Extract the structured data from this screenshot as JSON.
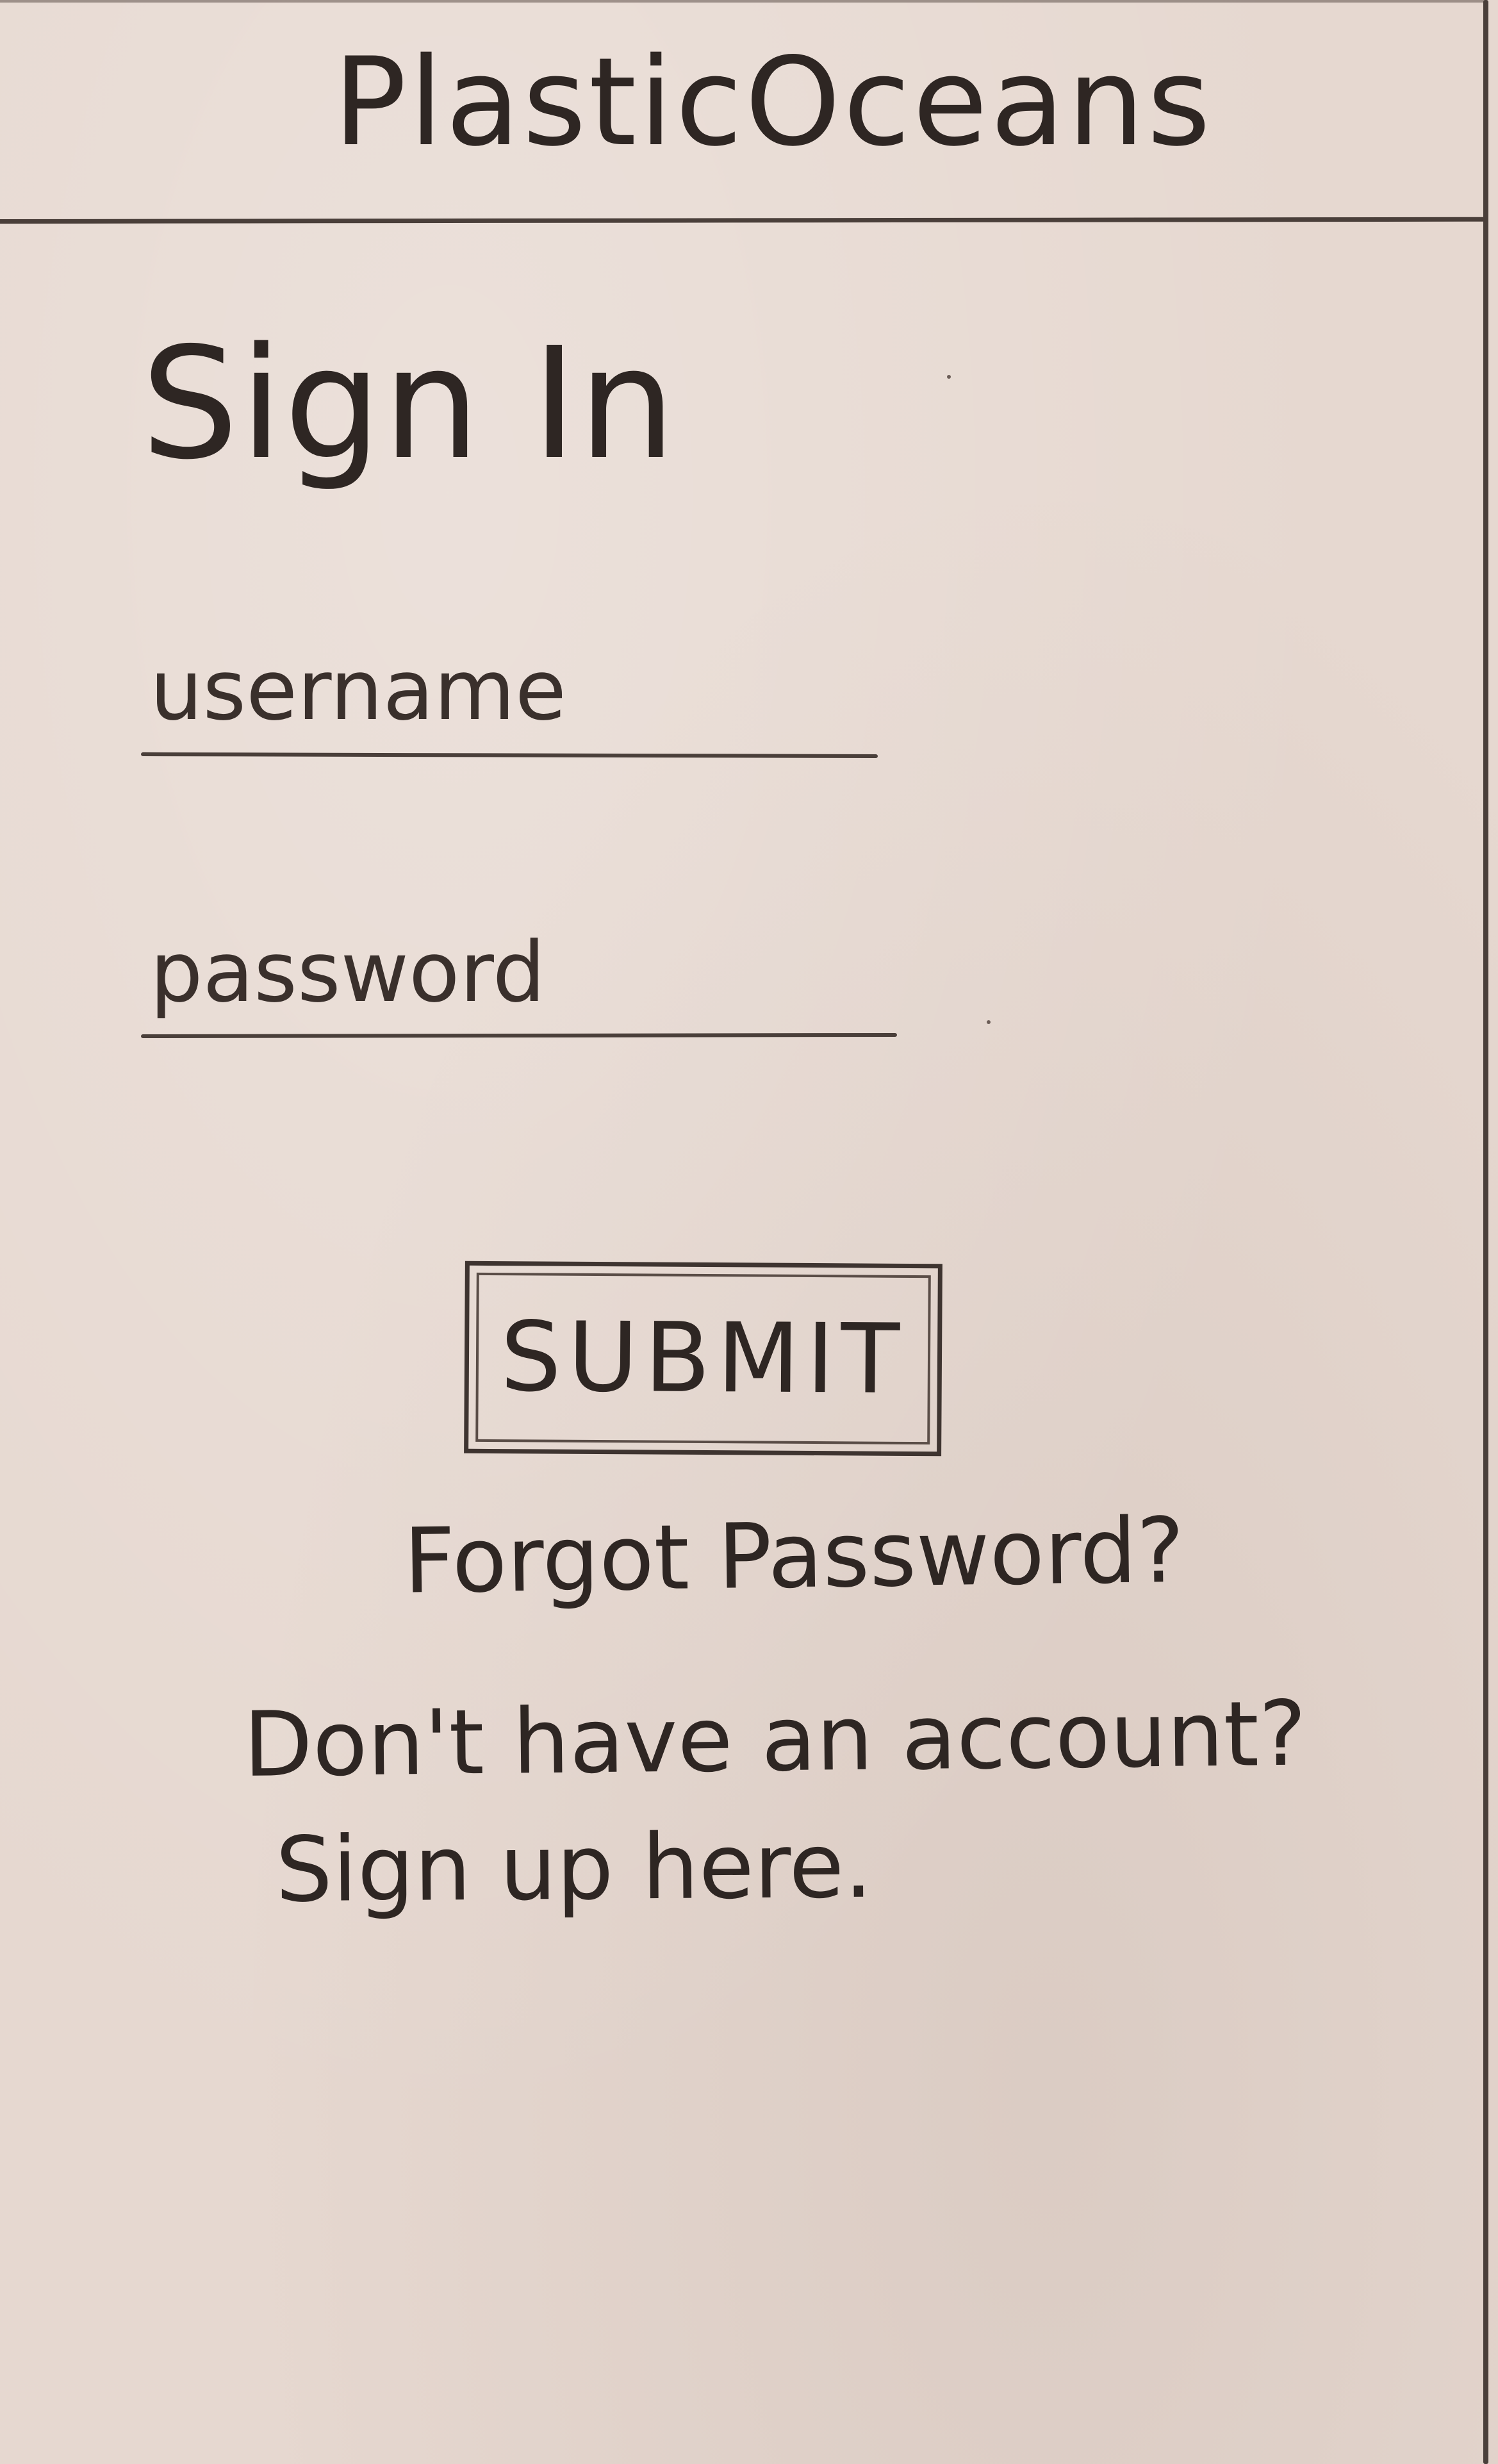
{
  "header": {
    "app_title": "PlasticOceans"
  },
  "signin": {
    "heading": "Sign In",
    "username_placeholder": "username",
    "password_placeholder": "password",
    "submit_label": "SUBMIT",
    "forgot_password_label": "Forgot Password?",
    "signup_prompt": "Don't have an account?",
    "signup_link_label": "Sign up here."
  }
}
